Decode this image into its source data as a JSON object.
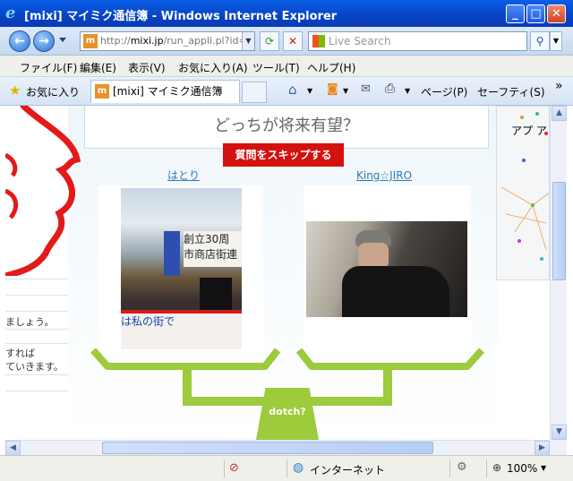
{
  "window": {
    "title": "[mixi] マイミク通信簿 - Windows Internet Explorer",
    "minimize": "_",
    "maximize": "□",
    "close": "✕"
  },
  "address": {
    "prefix": "http://",
    "host": "mixi.jp",
    "path": "/run_appli.pl?id=2"
  },
  "search": {
    "placeholder": "Live Search",
    "icon": "magnifier-icon"
  },
  "menu": [
    "ファイル(F)",
    "編集(E)",
    "表示(V)",
    "お気に入り(A)",
    "ツール(T)",
    "ヘルプ(H)"
  ],
  "tabs": {
    "favorites": "お気に入り",
    "active_tab": "[mixi] マイミク通信簿",
    "favicon": "m"
  },
  "commandbar": {
    "page": "ページ(P)",
    "safety": "セーフティ(S)",
    "more": "»"
  },
  "page": {
    "question": "どっちが将来有望？",
    "skip_button": "質問をスキップする",
    "left_name": "はとり",
    "right_name": "King☆JIRO",
    "center_label": "dotch?",
    "photo_banner": "は私の街で",
    "photo_sign_top": "創立30周",
    "photo_sign_bottom": "市商店街連",
    "left_text": [
      "ましょう。",
      "すれば",
      "ていきます。"
    ],
    "right_panel_text": "アプ ア"
  },
  "status": {
    "zone": "インターネット",
    "zoom": "100%"
  },
  "colors": {
    "accent_green": "#9ccb3b",
    "skip_red": "#d4110e",
    "link_blue": "#2e7bb5"
  }
}
